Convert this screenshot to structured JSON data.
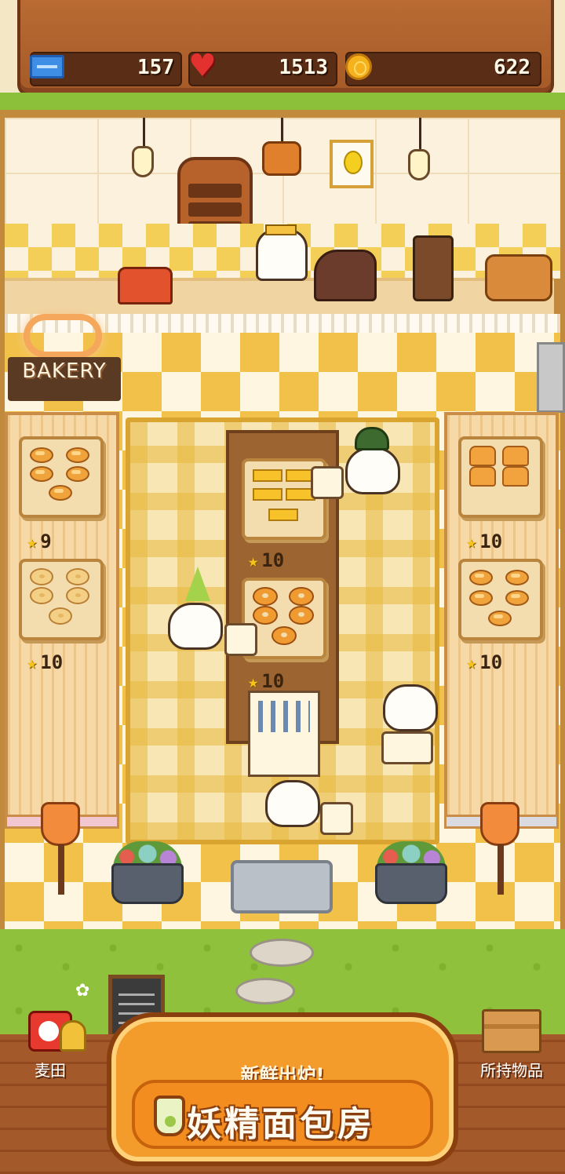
{
  "hud": {
    "tickets": "157",
    "hearts": "1513",
    "coins": "622",
    "icons": [
      "ticket-icon",
      "heart-icon",
      "coin-icon"
    ]
  },
  "shop": {
    "sign_text": "BAKERY"
  },
  "shelves": {
    "left_top_stock": "9",
    "left_bottom_stock": "10",
    "center_top_stock": "10",
    "center_middle_stock": "10",
    "right_top_stock": "10",
    "right_bottom_stock": "10"
  },
  "bottom": {
    "field_label": "麦田",
    "items_label": "所持物品",
    "subtitle": "新鲜出炉!",
    "title": "妖精面包房"
  },
  "colors": {
    "floor_yellow": "#f2c14a",
    "grass": "#8fc13c",
    "banner_orange": "#f39b2b"
  }
}
